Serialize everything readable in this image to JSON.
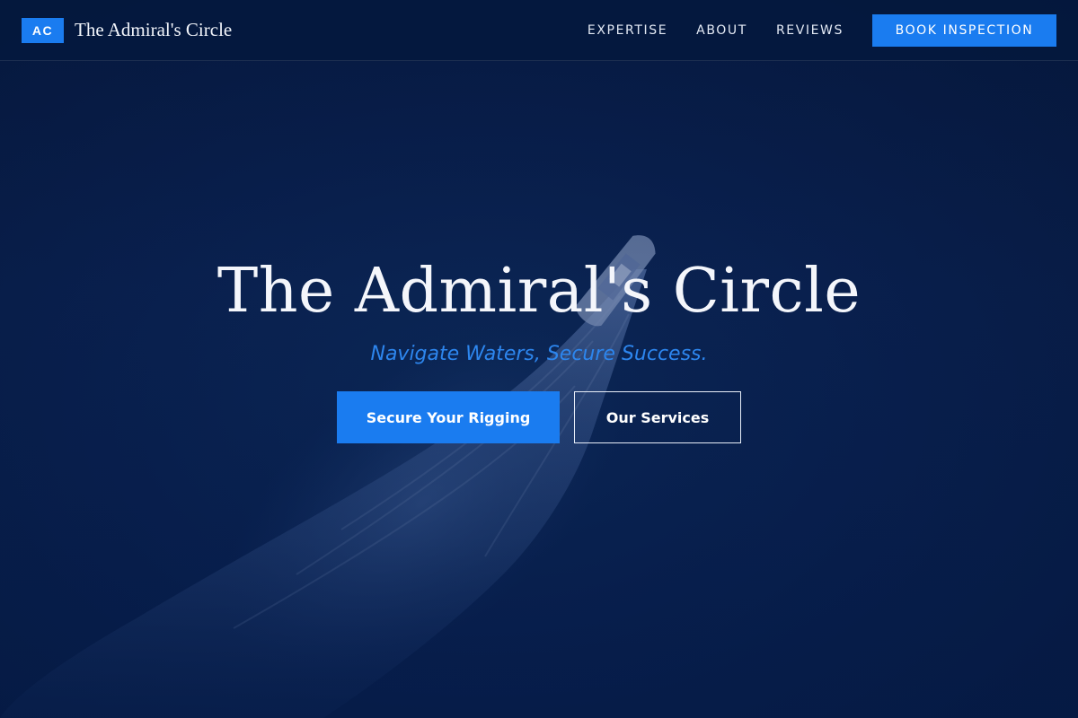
{
  "header": {
    "logo_badge": "AC",
    "brand_name": "The Admiral's Circle",
    "nav": [
      {
        "label": "EXPERTISE"
      },
      {
        "label": "ABOUT"
      },
      {
        "label": "REVIEWS"
      }
    ],
    "cta_label": "BOOK INSPECTION"
  },
  "hero": {
    "title": "The Admiral's Circle",
    "tagline": "Navigate Waters, Secure Success.",
    "primary_button": "Secure Your Rigging",
    "secondary_button": "Our Services",
    "background_image": "aerial-boat-wake-image"
  },
  "colors": {
    "accent": "#1a7cf0",
    "background": "#0a1e45",
    "header_bg": "#04183e",
    "tagline": "#2d86ee"
  }
}
